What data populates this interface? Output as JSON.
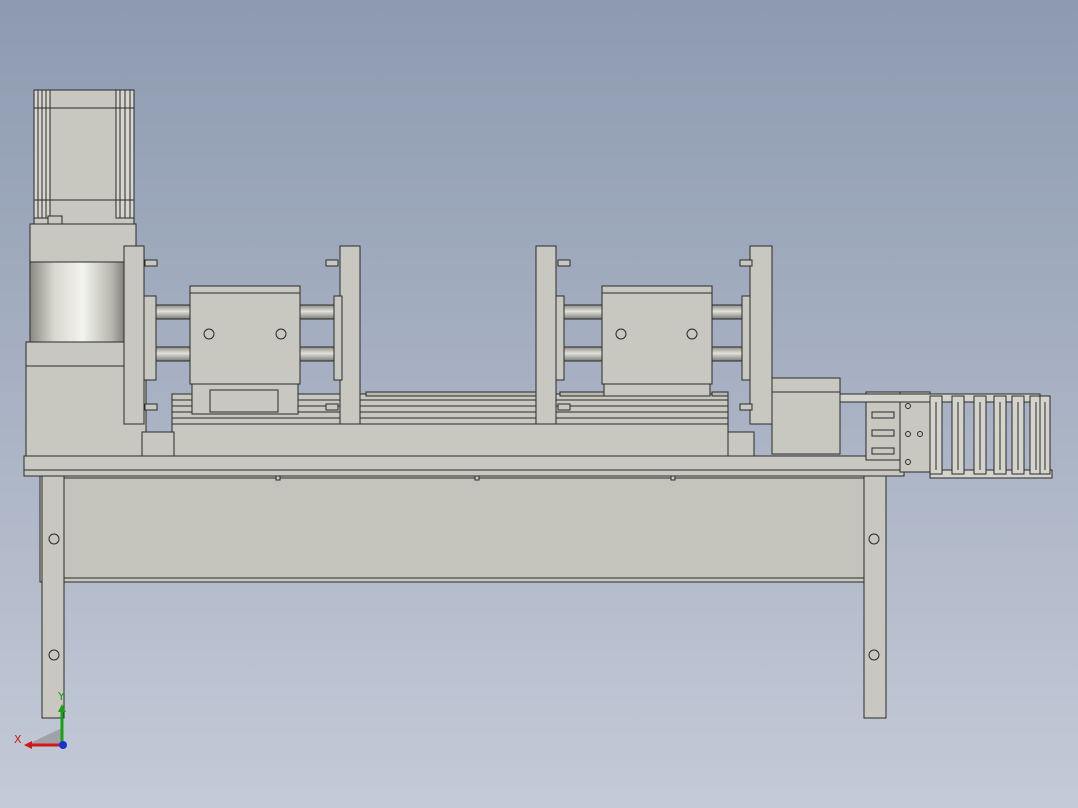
{
  "triad": {
    "x_label": "X",
    "y_label": "Y"
  },
  "colors": {
    "bg_top": "#8d9ab0",
    "bg_bottom": "#c3c9d6",
    "part": "#c8c8c0",
    "edge": "#2a2a2a",
    "x_axis": "#d01818",
    "y_axis": "#18a018",
    "z_axis": "#1830d0"
  }
}
